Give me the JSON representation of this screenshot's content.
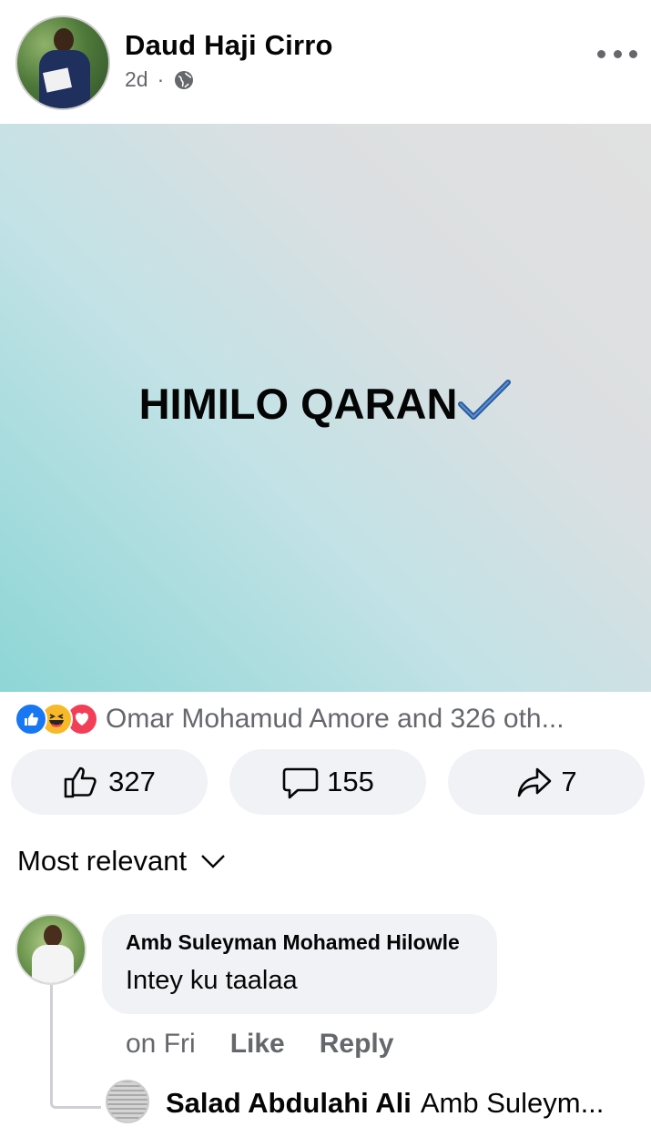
{
  "post": {
    "author": "Daud Haji Cirro",
    "time": "2d",
    "separator": "·",
    "privacy_icon": "globe-icon",
    "menu_icon": "more-icon",
    "text": "HIMILO QARAN"
  },
  "reactions": {
    "icons": [
      "like-icon",
      "haha-icon",
      "love-icon"
    ],
    "summary": "Omar Mohamud Amore and 326 oth..."
  },
  "actions": {
    "like_count": "327",
    "comment_count": "155",
    "share_count": "7"
  },
  "comments_sort": {
    "label": "Most relevant"
  },
  "comment": {
    "author": "Amb Suleyman Mohamed Hilowle",
    "text": "Intey ku taalaa",
    "time": "on Fri",
    "like_label": "Like",
    "reply_label": "Reply"
  },
  "reply": {
    "author": "Salad Abdulahi Ali",
    "text": "Amb Suleym..."
  },
  "colors": {
    "brand_blue": "#1877f2",
    "secondary_text": "#65676b",
    "button_bg": "#f0f2f5"
  }
}
